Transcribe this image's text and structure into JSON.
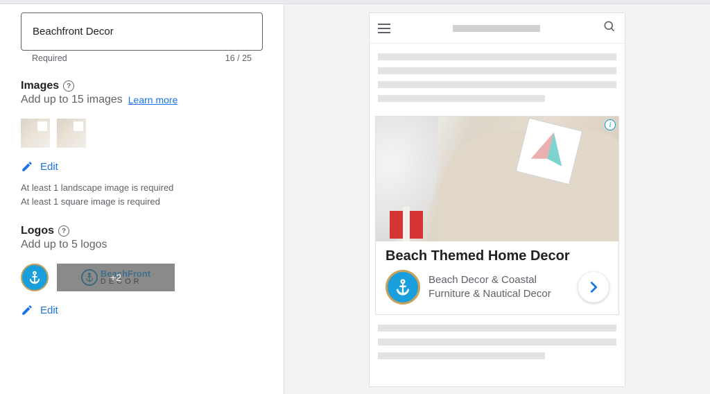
{
  "input": {
    "value": "Beachfront Decor",
    "required_label": "Required",
    "char_count": "16 / 25"
  },
  "images_section": {
    "title": "Images",
    "subtitle": "Add up to 15 images",
    "learn_more": "Learn more",
    "edit_label": "Edit",
    "helper_line1": "At least 1 landscape image is required",
    "helper_line2": "At least 1 square image is required"
  },
  "logos_section": {
    "title": "Logos",
    "subtitle": "Add up to 5 logos",
    "overlay_count": "+2",
    "edit_label": "Edit",
    "logo_text_top": "BeachFront",
    "logo_text_bottom": "DECOR"
  },
  "preview": {
    "ad_title": "Beach Themed Home Decor",
    "ad_line1": "Beach Decor & Coastal",
    "ad_line2": "Furniture & Nautical Decor"
  }
}
